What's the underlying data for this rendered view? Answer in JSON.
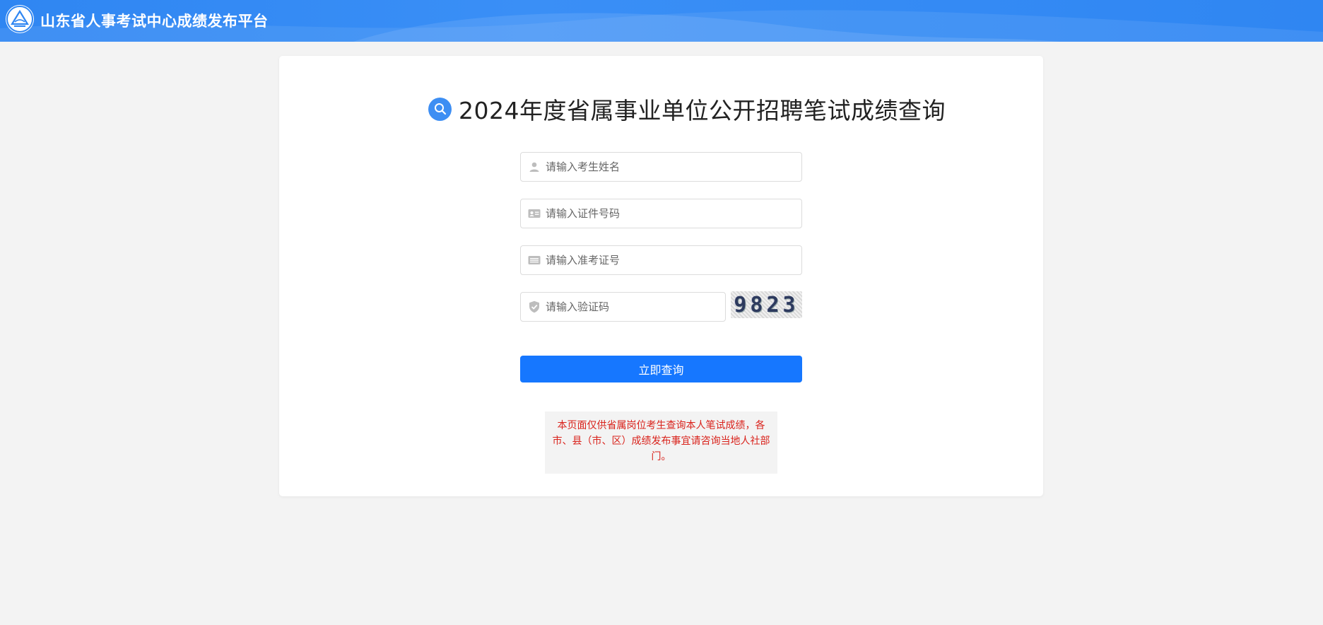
{
  "header": {
    "site_title": "山东省人事考试中心成绩发布平台",
    "logo_icon": "provincial-exam-center-logo"
  },
  "main": {
    "page_title": "2024年度省属事业单位公开招聘笔试成绩查询",
    "title_icon": "search-icon"
  },
  "form": {
    "name_placeholder": "请输入考生姓名",
    "id_placeholder": "请输入证件号码",
    "ticket_placeholder": "请输入准考证号",
    "captcha_placeholder": "请输入验证码",
    "captcha_code": "9823",
    "submit_label": "立即查询"
  },
  "notice": {
    "text": "本页面仅供省属岗位考生查询本人笔试成绩，各市、县（市、区）成绩发布事宜请咨询当地人社部门。"
  },
  "colors": {
    "header_blue": "#2f86f2",
    "primary_button": "#1677ff",
    "notice_red": "#d9221b",
    "page_background": "#f3f3f3"
  }
}
